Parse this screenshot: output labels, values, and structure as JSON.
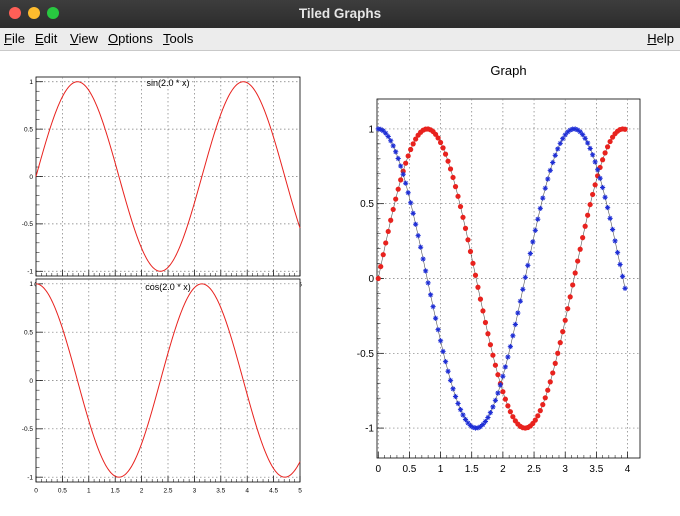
{
  "window": {
    "title": "Tiled Graphs"
  },
  "menubar": {
    "items": [
      {
        "mnemonic": "F",
        "rest": "ile"
      },
      {
        "mnemonic": "E",
        "rest": "dit"
      },
      {
        "mnemonic": "V",
        "rest": "iew"
      },
      {
        "mnemonic": "O",
        "rest": "ptions"
      },
      {
        "mnemonic": "T",
        "rest": "ools"
      }
    ],
    "help": {
      "mnemonic": "H",
      "rest": "elp"
    }
  },
  "colors": {
    "curve": "#e8221e",
    "marker_red": "#e8221e",
    "marker_blue": "#1e2ed6",
    "grid": "#7a7a7a"
  },
  "chart_data": [
    {
      "type": "line",
      "title": "sin(2.0 * x)",
      "function": "sin(2*x)",
      "xlim": [
        0,
        5
      ],
      "ylim": [
        -1.05,
        1.05
      ],
      "xticks": [
        "0",
        "0.5",
        "1",
        "1.5",
        "2",
        "2.5",
        "3",
        "3.5",
        "4",
        "4.5",
        "5"
      ],
      "yticks": [
        "-1",
        "-0.5",
        "0",
        "0.5",
        "1"
      ],
      "grid": true
    },
    {
      "type": "line",
      "title": "cos(2.0 * x)",
      "function": "cos(2*x)",
      "xlim": [
        0,
        5
      ],
      "ylim": [
        -1.05,
        1.05
      ],
      "xticks": [
        "0",
        "0.5",
        "1",
        "1.5",
        "2",
        "2.5",
        "3",
        "3.5",
        "4",
        "4.5",
        "5"
      ],
      "yticks": [
        "-1",
        "-0.5",
        "0",
        "0.5",
        "1"
      ],
      "grid": true
    },
    {
      "type": "scatter",
      "title": "Graph",
      "xlim": [
        -0.02,
        4.2
      ],
      "ylim": [
        -1.2,
        1.2
      ],
      "xticks": [
        "0",
        "0.5",
        "1",
        "1.5",
        "2",
        "2.5",
        "3",
        "3.5",
        "4"
      ],
      "yticks": [
        "-1",
        "-0.5",
        "0",
        "0.5",
        "1"
      ],
      "grid": true,
      "series": [
        {
          "marker": "circle",
          "color": "#e8221e",
          "function": "sin(2*x)",
          "x_start": 0,
          "x_step": 0.04,
          "count": 100
        },
        {
          "marker": "star",
          "color": "#1e2ed6",
          "function": "cos(2*x)",
          "x_start": 0,
          "x_step": 0.04,
          "count": 100
        }
      ]
    }
  ]
}
